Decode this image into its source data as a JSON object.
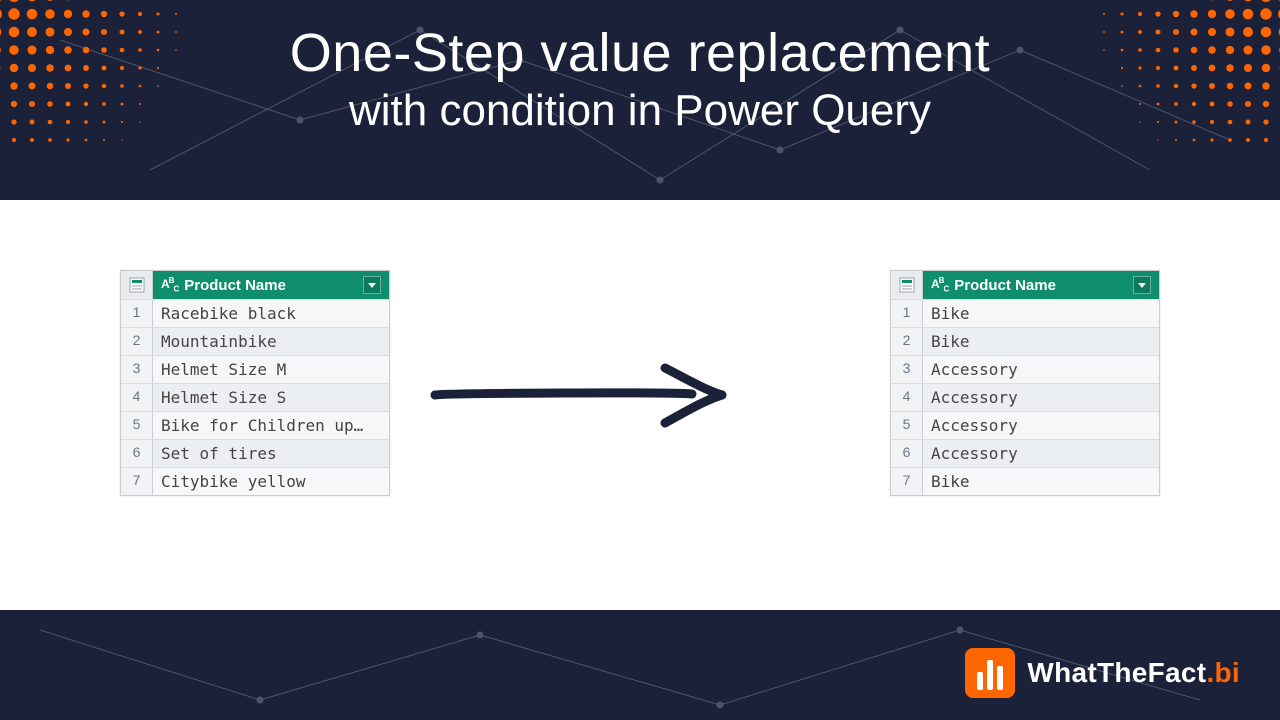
{
  "header": {
    "title": "One-Step value replacement",
    "subtitle": "with condition in Power Query"
  },
  "column_header": "Product Name",
  "table_left": {
    "rows": [
      {
        "n": "1",
        "v": "Racebike black"
      },
      {
        "n": "2",
        "v": "Mountainbike"
      },
      {
        "n": "3",
        "v": "Helmet Size M"
      },
      {
        "n": "4",
        "v": "Helmet Size S"
      },
      {
        "n": "5",
        "v": "Bike for Children up…"
      },
      {
        "n": "6",
        "v": "Set of tires"
      },
      {
        "n": "7",
        "v": "Citybike yellow"
      }
    ]
  },
  "table_right": {
    "rows": [
      {
        "n": "1",
        "v": "Bike"
      },
      {
        "n": "2",
        "v": "Bike"
      },
      {
        "n": "3",
        "v": "Accessory"
      },
      {
        "n": "4",
        "v": "Accessory"
      },
      {
        "n": "5",
        "v": "Accessory"
      },
      {
        "n": "6",
        "v": "Accessory"
      },
      {
        "n": "7",
        "v": "Bike"
      }
    ]
  },
  "brand": {
    "name": "WhatTheFact",
    "suffix": ".bi"
  },
  "colors": {
    "band": "#1a2138",
    "accent": "#ff6600",
    "table_header": "#0e8e6d"
  }
}
